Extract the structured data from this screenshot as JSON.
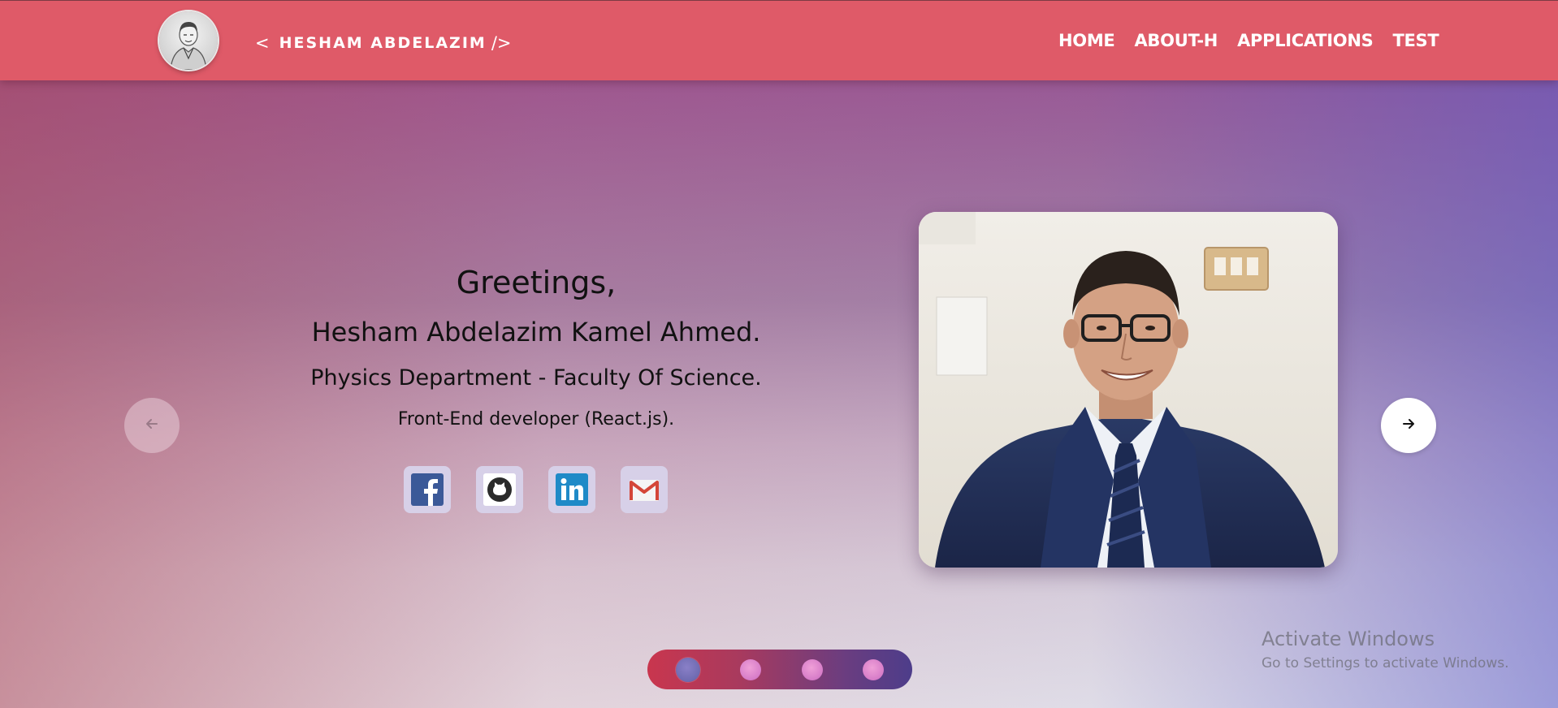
{
  "header": {
    "brand_open": "<",
    "brand_name": "HESHAM ABDELAZIM",
    "brand_close": "/>",
    "avatar_icon": "portrait-sketch-icon",
    "nav": [
      {
        "label": "HOME"
      },
      {
        "label": "ABOUT-H"
      },
      {
        "label": "APPLICATIONS"
      },
      {
        "label": "TEST"
      }
    ],
    "bg_color": "#df5a68"
  },
  "hero": {
    "greeting": "Greetings,",
    "name": "Hesham Abdelazim Kamel Ahmed.",
    "department": "Physics Department - Faculty Of Science.",
    "role": "Front-End developer (React.js).",
    "socials": [
      {
        "icon": "facebook-icon"
      },
      {
        "icon": "github-icon"
      },
      {
        "icon": "linkedin-icon"
      },
      {
        "icon": "gmail-icon"
      }
    ],
    "photo_subject": "portrait-photo",
    "prev_icon": "arrow-left-icon",
    "next_icon": "arrow-right-icon"
  },
  "carousel": {
    "slide_count": 4,
    "active_index": 0
  },
  "watermark": {
    "title": "Activate Windows",
    "subtitle": "Go to Settings to activate Windows."
  }
}
